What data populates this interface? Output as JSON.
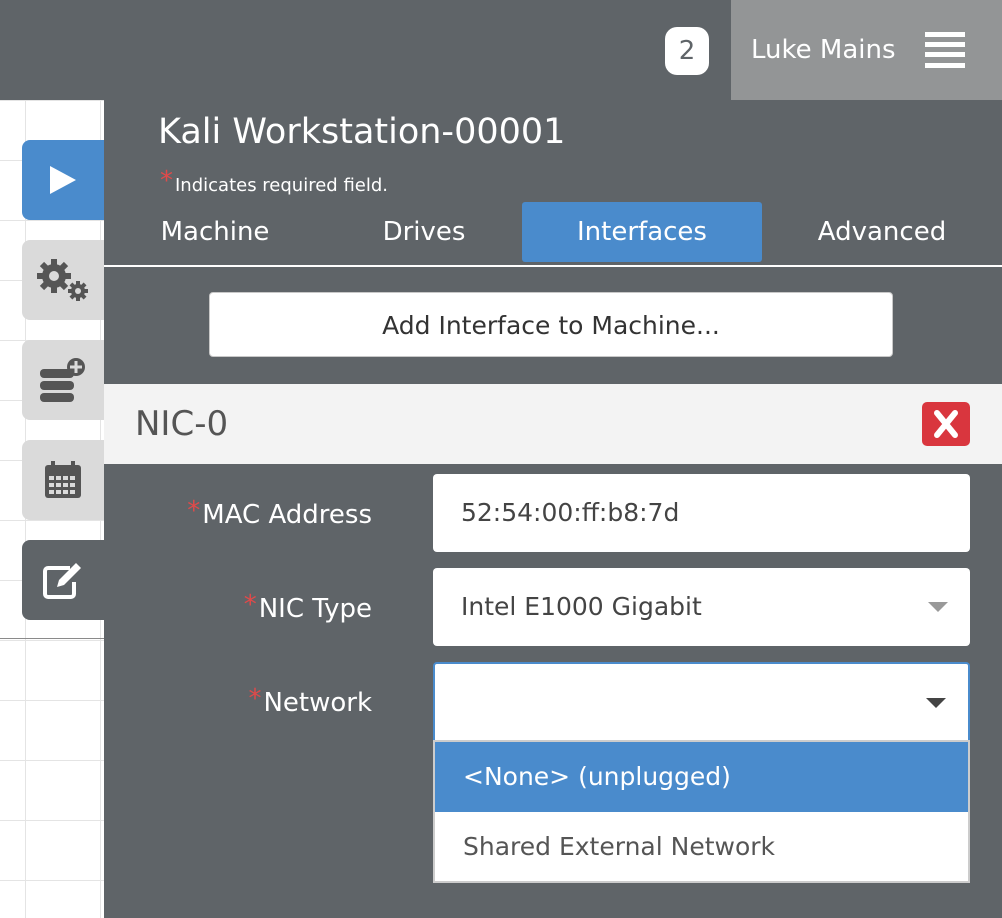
{
  "header": {
    "notification_count": "2",
    "user_name": "Luke Mains"
  },
  "side_tabs": [
    "play",
    "settings",
    "drives",
    "calendar",
    "edit"
  ],
  "panel": {
    "title": "Kali Workstation-00001",
    "required_star": "*",
    "required_note": "Indicates required field.",
    "tabs": [
      "Machine",
      "Drives",
      "Interfaces",
      "Advanced"
    ],
    "active_tab": "Interfaces",
    "add_interface_label": "Add Interface to Machine..."
  },
  "nic": {
    "title": "NIC-0",
    "fields": {
      "mac_label": "MAC Address",
      "mac_value": "52:54:00:ff:b8:7d",
      "type_label": "NIC Type",
      "type_value": "Intel E1000 Gigabit",
      "network_label": "Network",
      "network_value": ""
    },
    "network_options": [
      "<None> (unplugged)",
      "Shared External Network"
    ],
    "highlighted_option": "<None> (unplugged)"
  },
  "colors": {
    "accent": "#4a8bcc",
    "panel": "#5f6468",
    "danger": "#d9363e",
    "required": "#e04a4a"
  }
}
